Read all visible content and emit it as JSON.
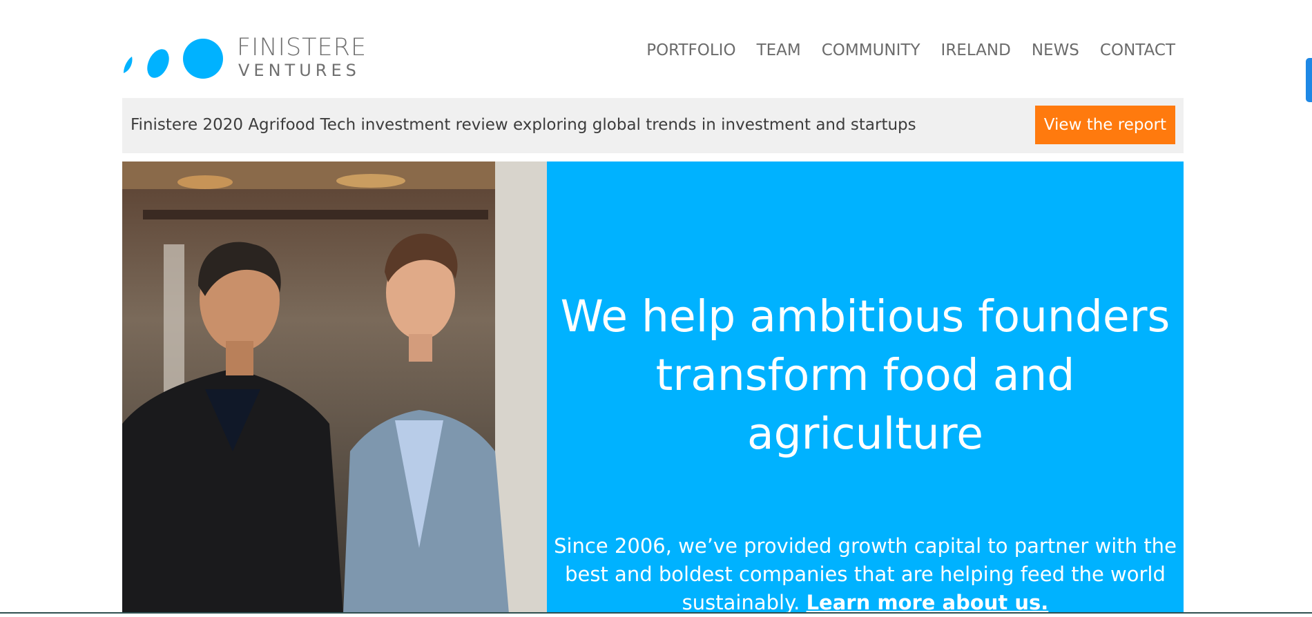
{
  "brand": {
    "name_line1": "FINISTERE",
    "name_line2": "VENTURES",
    "accent_color": "#00b2ff"
  },
  "nav": {
    "items": [
      "PORTFOLIO",
      "TEAM",
      "COMMUNITY",
      "IRELAND",
      "NEWS",
      "CONTACT"
    ]
  },
  "banner": {
    "text": "Finistere 2020 Agrifood Tech investment review exploring global trends in investment and startups",
    "button_label": "View the report",
    "button_color": "#ff7a0e"
  },
  "hero": {
    "headline": "We help ambitious founders transform food and agriculture",
    "sub_text": "Since 2006, we’ve provided growth capital to partner with the best and boldest companies that are helping feed the world sustainably.",
    "link_text": "Learn more about us."
  }
}
